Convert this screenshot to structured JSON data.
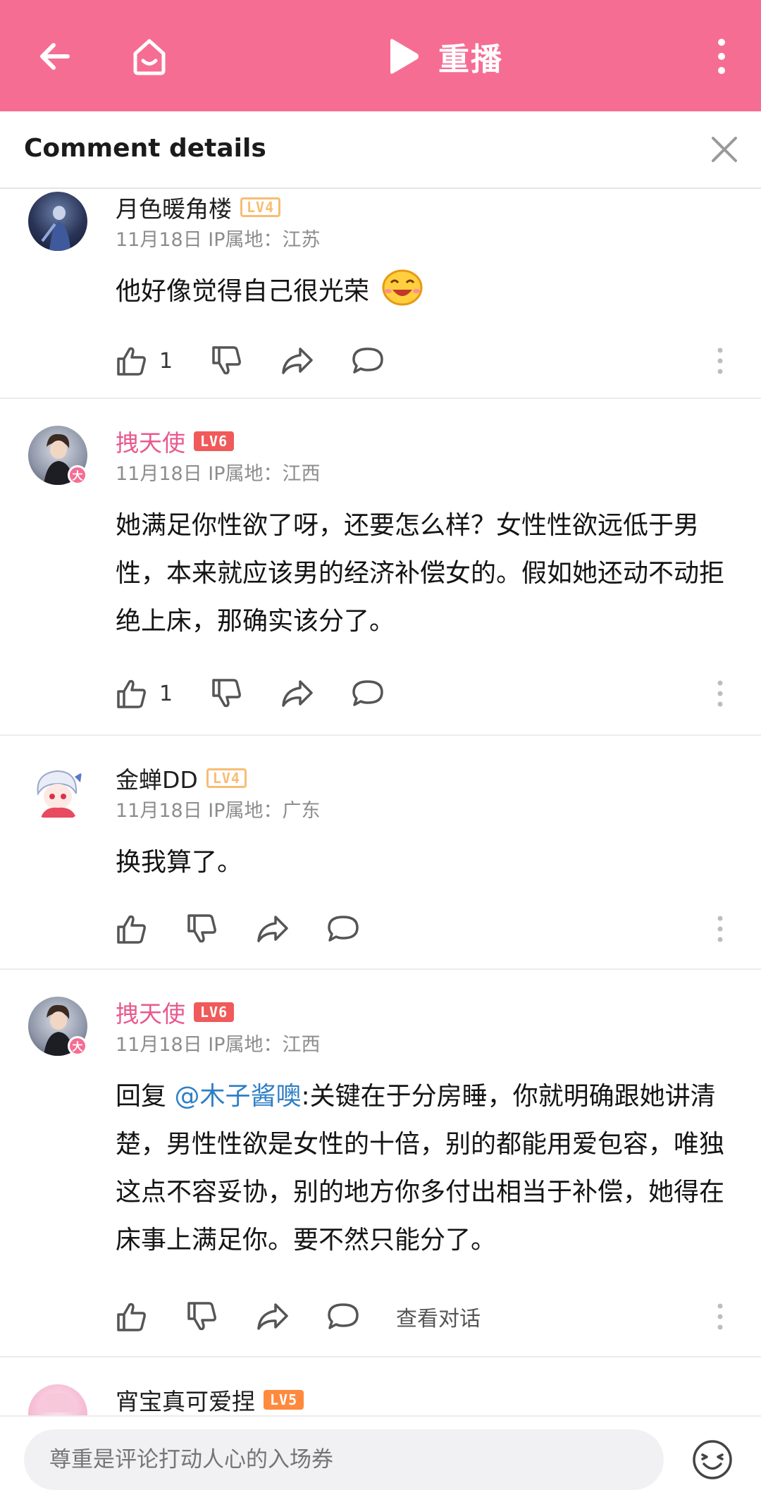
{
  "topbar": {
    "replay_label": "重播",
    "bg_color": "#f66d93",
    "icons": [
      "back-arrow-icon",
      "home-icon",
      "play-icon",
      "more-vertical-icon"
    ]
  },
  "panel": {
    "title": "Comment details"
  },
  "comments": [
    {
      "username": "月色暖角楼",
      "level": "LV4",
      "meta": "11月18日 IP属地：江苏",
      "content": "他好像觉得自己很光荣",
      "likes": "1"
    },
    {
      "username": "拽天使",
      "level": "LV6",
      "badge": "大",
      "meta": "11月18日 IP属地：江西",
      "content": "她满足你性欲了呀，还要怎么样？女性性欲远低于男性，本来就应该男的经济补偿女的。假如她还动不动拒绝上床，那确实该分了。",
      "likes": "1"
    },
    {
      "username": "金蝉DD",
      "level": "LV4",
      "meta": "11月18日 IP属地：广东",
      "content": "换我算了。"
    },
    {
      "username": "拽天使",
      "level": "LV6",
      "badge": "大",
      "meta": "11月18日 IP属地：江西",
      "reply_prefix": "回复 ",
      "mention": "@木子酱噢",
      "content": ":关键在于分房睡，你就明确跟她讲清楚，男性性欲是女性的十倍，别的都能用爱包容，唯独这点不容妥协，别的地方你多付出相当于补偿，她得在床事上满足你。要不然只能分了。",
      "view_conversation": "查看对话"
    },
    {
      "username": "宵宝真可爱捏",
      "level": "LV5"
    }
  ],
  "bottom": {
    "placeholder": "尊重是评论打动人心的入场券"
  }
}
